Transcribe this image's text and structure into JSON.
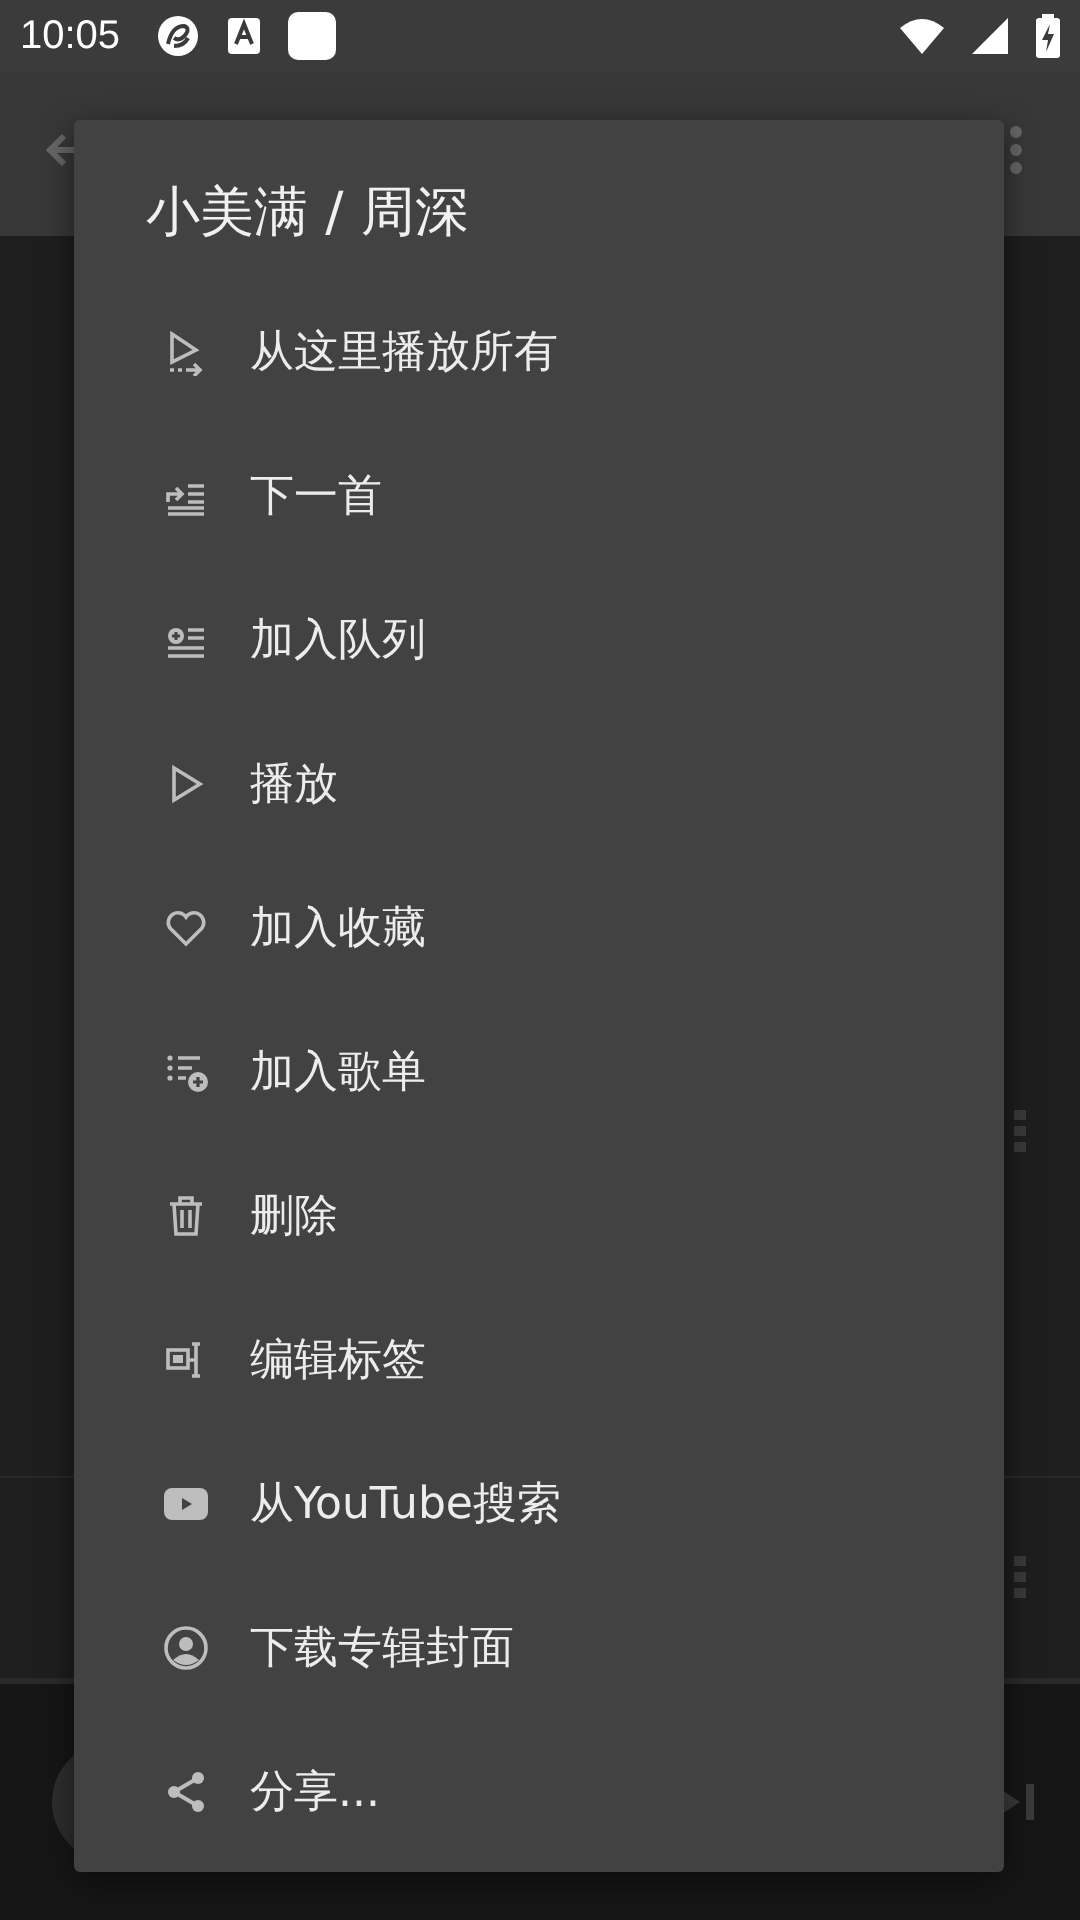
{
  "status_bar": {
    "time": "10:05"
  },
  "menu": {
    "title": "小美满 / 周深",
    "items": [
      {
        "label": "从这里播放所有"
      },
      {
        "label": "下一首"
      },
      {
        "label": "加入队列"
      },
      {
        "label": "播放"
      },
      {
        "label": "加入收藏"
      },
      {
        "label": "加入歌单"
      },
      {
        "label": "删除"
      },
      {
        "label": "编辑标签"
      },
      {
        "label": "从YouTube搜索"
      },
      {
        "label": "下载专辑封面"
      },
      {
        "label": "分享..."
      }
    ]
  }
}
